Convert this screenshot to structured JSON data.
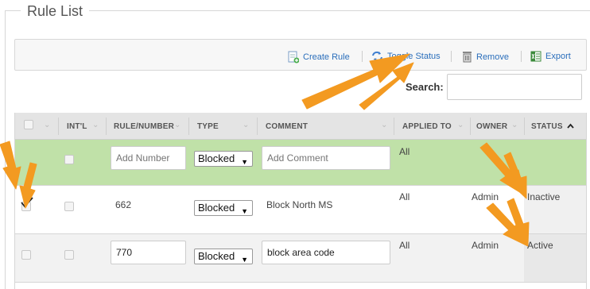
{
  "panel": {
    "title": "Rule List"
  },
  "toolbar": {
    "create_label": "Create Rule",
    "toggle_label": "Toggle Status",
    "remove_label": "Remove",
    "export_label": "Export"
  },
  "search": {
    "label": "Search:",
    "placeholder": ""
  },
  "table": {
    "columns": [
      "INT'L",
      "RULE/NUMBER",
      "TYPE",
      "COMMENT",
      "APPLIED TO",
      "OWNER",
      "STATUS"
    ],
    "add_row": {
      "number_placeholder": "Add Number",
      "type": "Blocked",
      "comment_placeholder": "Add Comment",
      "applied_to": "All"
    },
    "rows": [
      {
        "number": "662",
        "type": "Blocked",
        "comment": "Block North MS",
        "applied_to": "All",
        "owner": "Admin",
        "status": "Inactive",
        "checked": true
      },
      {
        "number": "770",
        "type": "Blocked",
        "comment": "block area code",
        "applied_to": "All",
        "owner": "Admin",
        "status": "Active",
        "checked": false
      }
    ],
    "sort_icon": "caret-up-icon"
  },
  "colors": {
    "accent_link": "#2a6ebb",
    "highlight_row": "#c0e1a8",
    "annotation_arrow": "#f39a21"
  }
}
